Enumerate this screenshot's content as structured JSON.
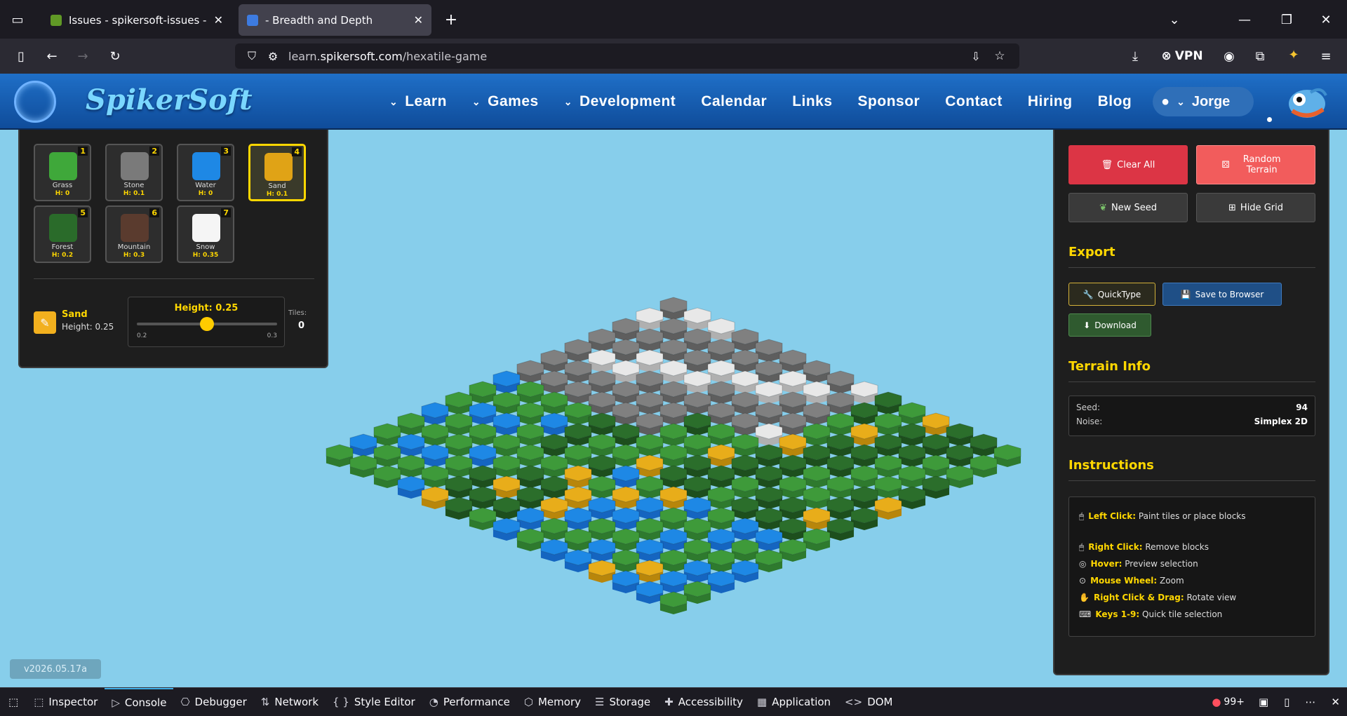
{
  "browser": {
    "tabs": [
      {
        "title": "Issues - spikersoft-issues - Gitea",
        "favicon_color": "#609926"
      },
      {
        "title": "- Breadth and Depth",
        "favicon_color": "#3d7be0"
      }
    ],
    "url_prefix": "learn.",
    "url_host": "spikersoft.com",
    "url_path": "/hexatile-game",
    "vpn_label": "VPN"
  },
  "site": {
    "brand": "SpikerSoft",
    "menu": [
      {
        "label": "Learn",
        "dropdown": true
      },
      {
        "label": "Games",
        "dropdown": true
      },
      {
        "label": "Development",
        "dropdown": true
      },
      {
        "label": "Calendar",
        "dropdown": false
      },
      {
        "label": "Links",
        "dropdown": false
      },
      {
        "label": "Sponsor",
        "dropdown": false
      },
      {
        "label": "Contact",
        "dropdown": false
      },
      {
        "label": "Hiring",
        "dropdown": false
      },
      {
        "label": "Blog",
        "dropdown": false
      }
    ],
    "user": "Jorge"
  },
  "palette": {
    "tiles": [
      {
        "num": "1",
        "name": "Grass",
        "height": "H: 0",
        "color": "#3fa83a"
      },
      {
        "num": "2",
        "name": "Stone",
        "height": "H: 0.1",
        "color": "#7a7a7a"
      },
      {
        "num": "3",
        "name": "Water",
        "height": "H: 0",
        "color": "#1e88e5"
      },
      {
        "num": "4",
        "name": "Sand",
        "height": "H: 0.1",
        "color": "#e0a316",
        "selected": true
      },
      {
        "num": "5",
        "name": "Forest",
        "height": "H: 0.2",
        "color": "#2a6b2a"
      },
      {
        "num": "6",
        "name": "Mountain",
        "height": "H: 0.3",
        "color": "#5a3b2e"
      },
      {
        "num": "7",
        "name": "Snow",
        "height": "H: 0.35",
        "color": "#f5f5f5"
      }
    ],
    "current": {
      "name": "Sand",
      "height_text": "Height: 0.25",
      "slider_label": "Height: 0.25",
      "slider_min": "0.2",
      "slider_max": "0.3",
      "slider_value": 0.25,
      "tiles_label": "Tiles:",
      "tiles_count": "0"
    }
  },
  "controls": {
    "clear_all": "Clear All",
    "random_terrain": "Random Terrain",
    "new_seed": "New Seed",
    "hide_grid": "Hide Grid"
  },
  "export": {
    "title": "Export",
    "quicktype": "QuickType",
    "save_browser": "Save to Browser",
    "download": "Download"
  },
  "terrain_info": {
    "title": "Terrain Info",
    "seed_label": "Seed:",
    "seed_value": "94",
    "noise_label": "Noise:",
    "noise_value": "Simplex 2D"
  },
  "instructions": {
    "title": "Instructions",
    "items": [
      {
        "key": "Left Click:",
        "text": "Paint tiles or place blocks"
      },
      {
        "key": "Right Click:",
        "text": "Remove blocks"
      },
      {
        "key": "Hover:",
        "text": "Preview selection"
      },
      {
        "key": "Mouse Wheel:",
        "text": "Zoom"
      },
      {
        "key": "Right Click & Drag:",
        "text": "Rotate view"
      },
      {
        "key": "Keys 1-9:",
        "text": "Quick tile selection"
      }
    ]
  },
  "version": "v2026.05.17a",
  "devtools": {
    "tabs": [
      "Inspector",
      "Console",
      "Debugger",
      "Network",
      "Style Editor",
      "Performance",
      "Memory",
      "Storage",
      "Accessibility",
      "Application",
      "DOM"
    ],
    "active": "Console",
    "error_count": "99+"
  }
}
